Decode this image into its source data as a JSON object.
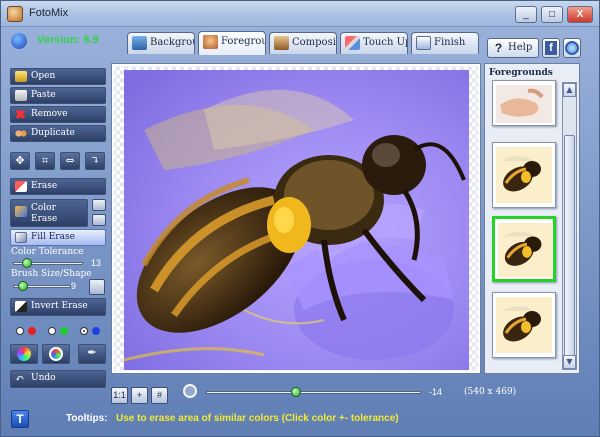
{
  "window": {
    "title": "FotoMix",
    "buttons": [
      "_",
      "□",
      "X"
    ]
  },
  "version": "Version: 8.9",
  "tabs": [
    {
      "label": "Backgroun",
      "icon": "background-icon"
    },
    {
      "label": "Foregroun",
      "icon": "foreground-icon"
    },
    {
      "label": "Compositio",
      "icon": "composition-icon"
    },
    {
      "label": "Touch Up",
      "icon": "touch-up-icon"
    },
    {
      "label": "Finish",
      "icon": "finish-icon"
    }
  ],
  "help_label": "Help",
  "left": {
    "open": "Open",
    "paste": "Paste",
    "remove": "Remove",
    "duplicate": "Duplicate",
    "erase": "Erase",
    "color_erase": [
      "Color",
      "Erase"
    ],
    "fill_erase": "Fill Erase",
    "color_tolerance_label": "Color Tolerance",
    "color_tolerance_value": "13",
    "color_tolerance_level": 13,
    "brush_label": "Brush Size/Shape",
    "brush_value": "9",
    "brush_level": 9,
    "invert_erase": "Invert Erase",
    "undo": "Undo"
  },
  "colors": {
    "accent_green": "#33d24a",
    "tooltip_yellow": "#f3e936",
    "selected_thumb": "#25d225"
  },
  "foregrounds": {
    "title": "Foregrounds",
    "selected_index": 2
  },
  "zoom": {
    "value": "-14",
    "level": 0.42
  },
  "image_size": "(540 x 469)",
  "zoom_buttons": [
    "1:1",
    "+",
    "#"
  ],
  "tooltip": {
    "label": "Tooltips:",
    "text": "Use to erase area of similar colors (Click color +- tolerance)"
  },
  "t_button": "T"
}
